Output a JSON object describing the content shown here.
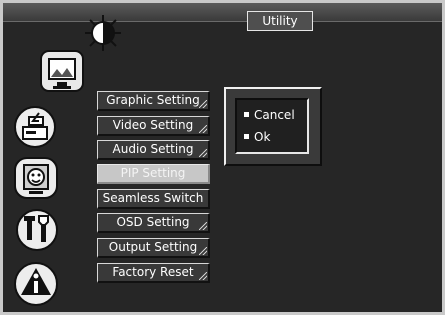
{
  "window": {
    "title": "Utility"
  },
  "icons": [
    {
      "name": "brightness-contrast-icon"
    },
    {
      "name": "picture-icon"
    },
    {
      "name": "input-source-icon"
    },
    {
      "name": "face-icon"
    },
    {
      "name": "tools-icon"
    },
    {
      "name": "info-icon"
    }
  ],
  "menu": {
    "items": [
      {
        "label": "Graphic Setting",
        "active": false
      },
      {
        "label": "Video Setting",
        "active": false
      },
      {
        "label": "Audio Setting",
        "active": false
      },
      {
        "label": "PIP Setting",
        "active": true
      },
      {
        "label": "Seamless Switch",
        "active": false
      },
      {
        "label": "OSD Setting",
        "active": false
      },
      {
        "label": "Output Setting",
        "active": false
      },
      {
        "label": "Factory Reset",
        "active": false
      }
    ]
  },
  "dialog": {
    "options": [
      {
        "label": "Cancel"
      },
      {
        "label": "Ok"
      }
    ]
  }
}
